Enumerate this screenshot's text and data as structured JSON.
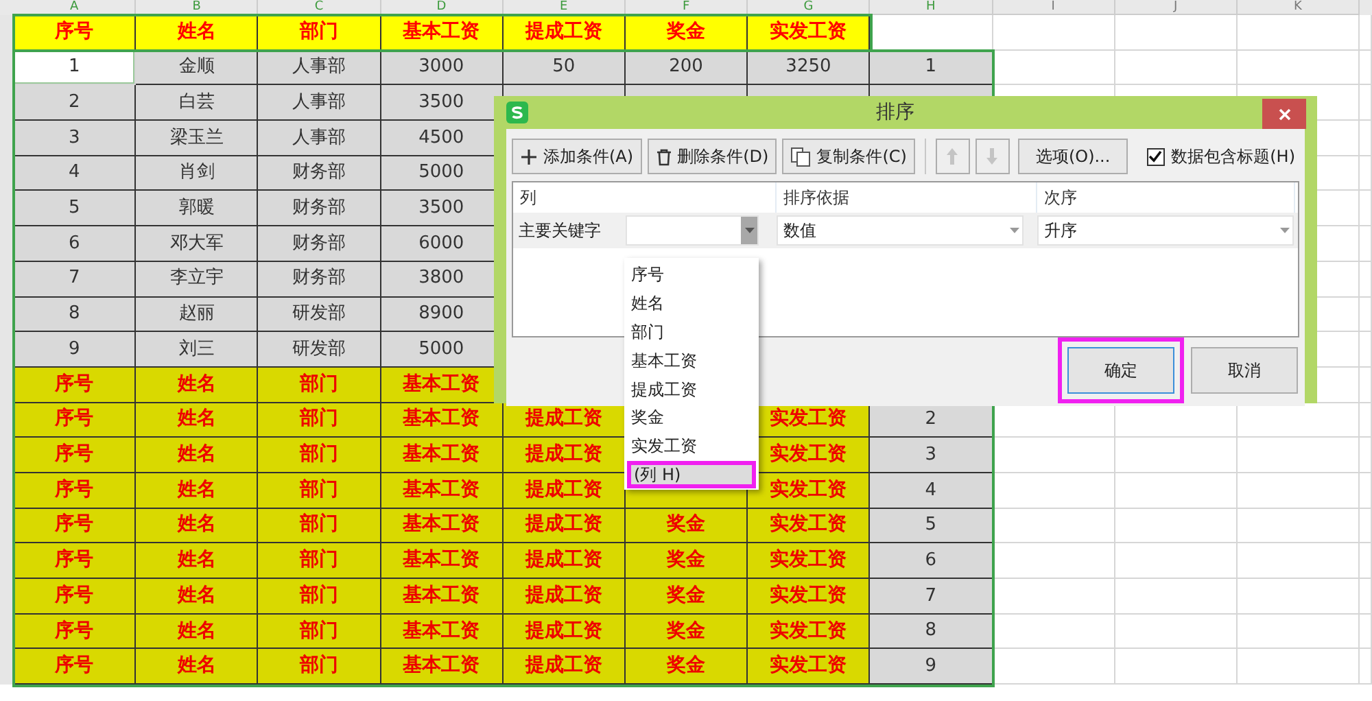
{
  "column_headers": [
    {
      "label": "A",
      "selected": true
    },
    {
      "label": "B",
      "selected": true
    },
    {
      "label": "C",
      "selected": true
    },
    {
      "label": "D",
      "selected": true
    },
    {
      "label": "E",
      "selected": true
    },
    {
      "label": "F",
      "selected": true
    },
    {
      "label": "G",
      "selected": true
    },
    {
      "label": "H",
      "selected": true
    },
    {
      "label": "I",
      "selected": false
    },
    {
      "label": "J",
      "selected": false
    },
    {
      "label": "K",
      "selected": false
    }
  ],
  "rows": [
    {
      "kind": "title",
      "active": false,
      "cells": [
        "序号",
        "姓名",
        "部门",
        "基本工资",
        "提成工资",
        "奖金",
        "实发工资",
        null
      ]
    },
    {
      "kind": "data",
      "active": true,
      "cells": [
        "1",
        "金顺",
        "人事部",
        "3000",
        "50",
        "200",
        "3250",
        "1"
      ]
    },
    {
      "kind": "data",
      "active": false,
      "cells": [
        "2",
        "白芸",
        "人事部",
        "3500",
        null,
        null,
        null,
        null
      ]
    },
    {
      "kind": "data",
      "active": false,
      "cells": [
        "3",
        "梁玉兰",
        "人事部",
        "4500",
        null,
        null,
        null,
        null
      ]
    },
    {
      "kind": "data",
      "active": false,
      "cells": [
        "4",
        "肖剑",
        "财务部",
        "5000",
        null,
        null,
        null,
        null
      ]
    },
    {
      "kind": "data",
      "active": false,
      "cells": [
        "5",
        "郭暖",
        "财务部",
        "3500",
        null,
        null,
        null,
        null
      ]
    },
    {
      "kind": "data",
      "active": false,
      "cells": [
        "6",
        "邓大军",
        "财务部",
        "6000",
        null,
        null,
        null,
        null
      ]
    },
    {
      "kind": "data",
      "active": false,
      "cells": [
        "7",
        "李立宇",
        "财务部",
        "3800",
        null,
        null,
        null,
        null
      ]
    },
    {
      "kind": "data",
      "active": false,
      "cells": [
        "8",
        "赵丽",
        "研发部",
        "8900",
        null,
        null,
        null,
        null
      ]
    },
    {
      "kind": "data",
      "active": false,
      "cells": [
        "9",
        "刘三",
        "研发部",
        "5000",
        null,
        null,
        null,
        null
      ]
    },
    {
      "kind": "repeat",
      "active": false,
      "cells": [
        "序号",
        "姓名",
        "部门",
        "基本工资",
        null,
        null,
        null,
        null
      ]
    },
    {
      "kind": "repeat",
      "active": false,
      "cells": [
        "序号",
        "姓名",
        "部门",
        "基本工资",
        "提成工资",
        null,
        "实发工资",
        "2"
      ]
    },
    {
      "kind": "repeat",
      "active": false,
      "cells": [
        "序号",
        "姓名",
        "部门",
        "基本工资",
        "提成工资",
        null,
        "实发工资",
        "3"
      ]
    },
    {
      "kind": "repeat",
      "active": false,
      "cells": [
        "序号",
        "姓名",
        "部门",
        "基本工资",
        "提成工资",
        null,
        "实发工资",
        "4"
      ]
    },
    {
      "kind": "repeat",
      "active": false,
      "cells": [
        "序号",
        "姓名",
        "部门",
        "基本工资",
        "提成工资",
        "奖金",
        "实发工资",
        "5"
      ]
    },
    {
      "kind": "repeat",
      "active": false,
      "cells": [
        "序号",
        "姓名",
        "部门",
        "基本工资",
        "提成工资",
        "奖金",
        "实发工资",
        "6"
      ]
    },
    {
      "kind": "repeat",
      "active": false,
      "cells": [
        "序号",
        "姓名",
        "部门",
        "基本工资",
        "提成工资",
        "奖金",
        "实发工资",
        "7"
      ]
    },
    {
      "kind": "repeat",
      "active": false,
      "cells": [
        "序号",
        "姓名",
        "部门",
        "基本工资",
        "提成工资",
        "奖金",
        "实发工资",
        "8"
      ]
    },
    {
      "kind": "repeat",
      "active": false,
      "cells": [
        "序号",
        "姓名",
        "部门",
        "基本工资",
        "提成工资",
        "奖金",
        "实发工资",
        "9"
      ]
    }
  ],
  "dialog": {
    "title": "排序",
    "toolbar": [
      {
        "kind": "add",
        "label": "添加条件(A)",
        "disabled": false
      },
      {
        "kind": "delete",
        "label": "删除条件(D)",
        "disabled": false
      },
      {
        "kind": "copy",
        "label": "复制条件(C)",
        "disabled": false
      },
      {
        "kind": "up",
        "disabled": true
      },
      {
        "kind": "down",
        "disabled": true
      },
      {
        "kind": "options",
        "label": "选项(O)...",
        "disabled": false
      }
    ],
    "has_header": {
      "label": "数据包含标题(H)",
      "checked": true
    },
    "columns": [
      "列",
      "排序依据",
      "次序"
    ],
    "condition": {
      "label": "主要关键字",
      "column_expanded": true,
      "sort_on": "数值",
      "order": "升序"
    },
    "options": [
      {
        "label": "序号",
        "selected": false,
        "marked": false
      },
      {
        "label": "姓名",
        "selected": false,
        "marked": false
      },
      {
        "label": "部门",
        "selected": false,
        "marked": false
      },
      {
        "label": "基本工资",
        "selected": false,
        "marked": false
      },
      {
        "label": "提成工资",
        "selected": false,
        "marked": false
      },
      {
        "label": "奖金",
        "selected": false,
        "marked": false
      },
      {
        "label": "实发工资",
        "selected": false,
        "marked": false
      },
      {
        "label": "(列 H)",
        "selected": true,
        "marked": true
      }
    ],
    "buttons": [
      {
        "label": "确定",
        "focused": true,
        "marked": true
      },
      {
        "label": "取消",
        "focused": false,
        "marked": false
      }
    ]
  }
}
